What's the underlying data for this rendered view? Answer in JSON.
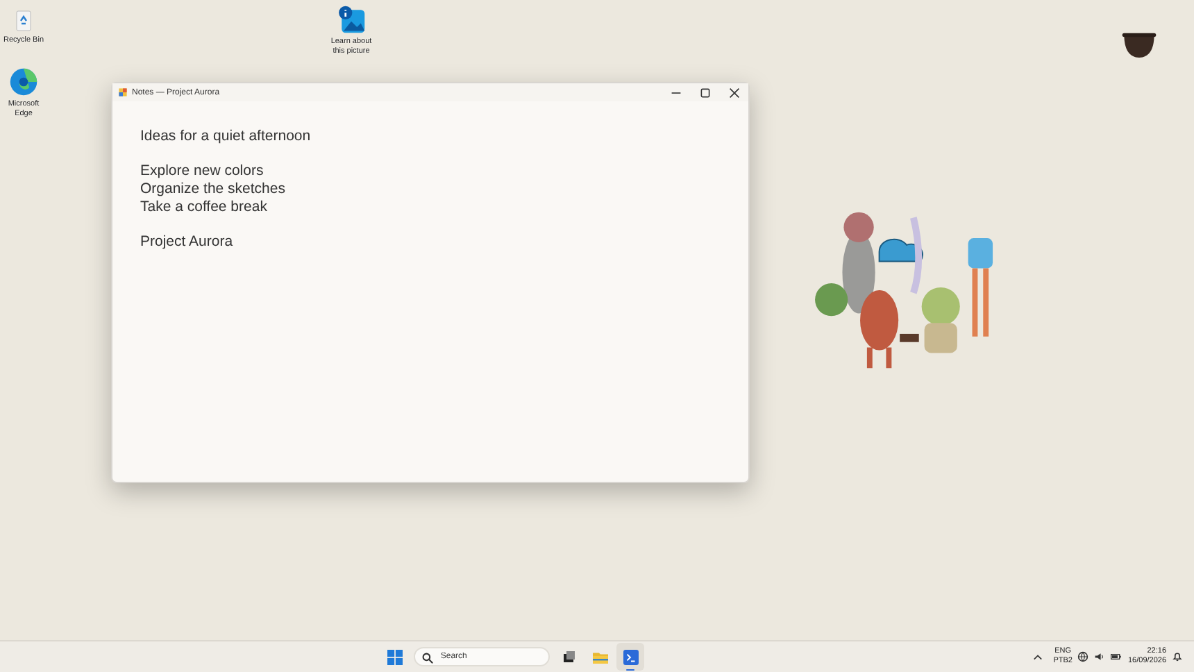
{
  "desktop_icons": [
    {
      "kind": "recycle",
      "label": "Recycle Bin"
    },
    {
      "kind": "browser",
      "label": "Microsoft Edge"
    },
    {
      "kind": "info",
      "label": "Learn about this picture"
    }
  ],
  "window": {
    "title": "Notes — Project Aurora",
    "paragraphs": [
      [
        "Ideas for a quiet afternoon"
      ],
      [
        "Explore new colors",
        "Organize the sketches",
        "Take a coffee break"
      ],
      [
        "Project Aurora"
      ]
    ]
  },
  "taskbar": {
    "search": {
      "placeholder": "Search"
    },
    "apps": [
      {
        "kind": "taskview",
        "running": false
      },
      {
        "kind": "folder",
        "running": false
      },
      {
        "kind": "terminal",
        "running": true
      }
    ],
    "tray": {
      "language": "ENG",
      "layout": "PTB2",
      "time": "22:16",
      "date": "16/09/2026"
    }
  }
}
